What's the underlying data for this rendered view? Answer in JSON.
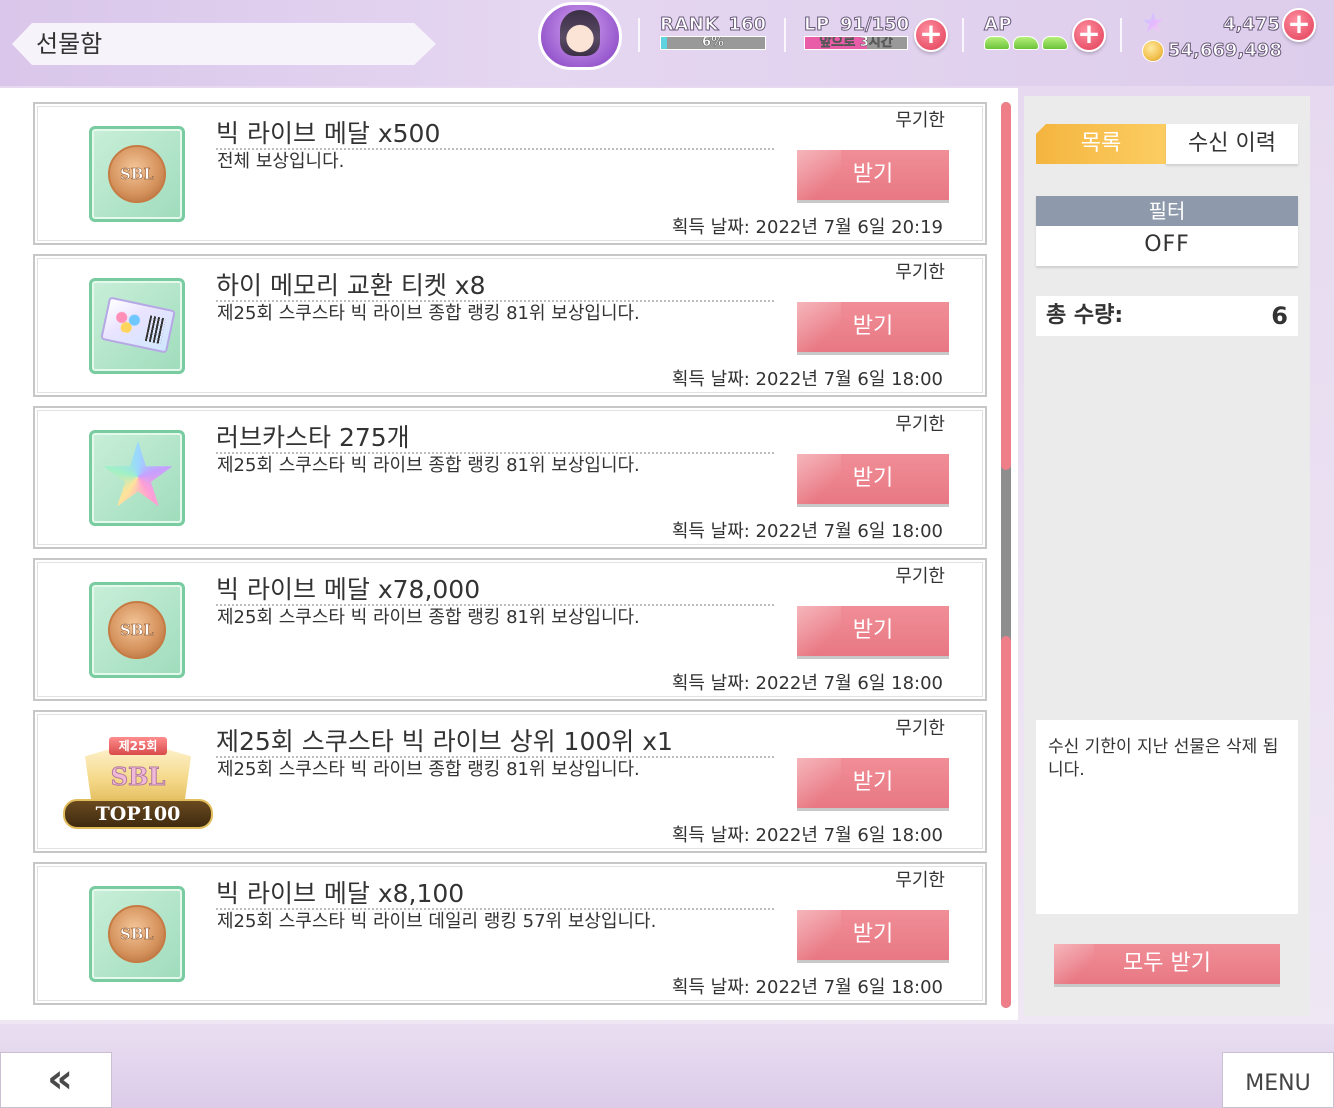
{
  "header": {
    "title": "선물함",
    "rank_label": "RANK",
    "rank_value": "160",
    "rank_progress_text": "6%",
    "rank_progress": 0.06,
    "lp_label": "LP",
    "lp_value": "91/150",
    "lp_timer": "앞으로 3시간",
    "lp_progress": 0.61,
    "ap_label": "AP",
    "ap_count": 3,
    "plus_symbol": "+",
    "stars_value": "4,475",
    "coins_value": "54,669,498",
    "icons": [
      "avatar-heart",
      "star-currency-icon",
      "coin-icon",
      "ap-shoe-icon",
      "plus-icon"
    ]
  },
  "gifts": [
    {
      "name": "빅 라이브 메달 x500",
      "desc": "전체 보상입니다.",
      "expiry": "무기한",
      "button": "받기",
      "date": "획득 날짜: 2022년 7월 6일 20:19",
      "icon": "medal-icon",
      "icon_text": "SBL"
    },
    {
      "name": "하이 메모리 교환 티켓 x8",
      "desc": "제25회 스쿠스타 빅 라이브 종합 랭킹 81위 보상입니다.",
      "expiry": "무기한",
      "button": "받기",
      "date": "획득 날짜: 2022년 7월 6일 18:00",
      "icon": "ticket-icon"
    },
    {
      "name": "러브카스타 275개",
      "desc": "제25회 스쿠스타 빅 라이브 종합 랭킹 81위 보상입니다.",
      "expiry": "무기한",
      "button": "받기",
      "date": "획득 날짜: 2022년 7월 6일 18:00",
      "icon": "lovecastar-icon"
    },
    {
      "name": "빅 라이브 메달 x78,000",
      "desc": "제25회 스쿠스타 빅 라이브 종합 랭킹 81위 보상입니다.",
      "expiry": "무기한",
      "button": "받기",
      "date": "획득 날짜: 2022년 7월 6일 18:00",
      "icon": "medal-icon",
      "icon_text": "SBL"
    },
    {
      "name": "제25회 스쿠스타 빅 라이브 상위 100위 x1",
      "desc": "제25회 스쿠스타 빅 라이브 종합 랭킹 81위 보상입니다.",
      "expiry": "무기한",
      "button": "받기",
      "date": "획득 날짜: 2022년 7월 6일 18:00",
      "icon": "top100-badge-icon",
      "badge_year": "제25회",
      "badge_logo": "SBL",
      "badge_rank": "TOP100"
    },
    {
      "name": "빅 라이브 메달 x8,100",
      "desc": "제25회 스쿠스타 빅 라이브 데일리 랭킹 57위 보상입니다.",
      "expiry": "무기한",
      "button": "받기",
      "date": "획득 날짜: 2022년 7월 6일 18:00",
      "icon": "medal-icon",
      "icon_text": "SBL"
    }
  ],
  "side": {
    "tab_list": "목록",
    "tab_history": "수신 이력",
    "filter_label": "필터",
    "filter_value": "OFF",
    "total_label": "총 수량:",
    "total_value": "6",
    "notice": "수신 기한이 지난 선물은 삭제 됩니다.",
    "receive_all": "모두 받기"
  },
  "footer": {
    "back_symbol": "«",
    "menu_label": "MENU"
  },
  "colors": {
    "accent_pink": "#e87883",
    "tab_active": "#f4b53f",
    "filter_header": "#8e9aab",
    "header_bg": "#d9c6ea",
    "icon_frame": "#78cca0"
  }
}
